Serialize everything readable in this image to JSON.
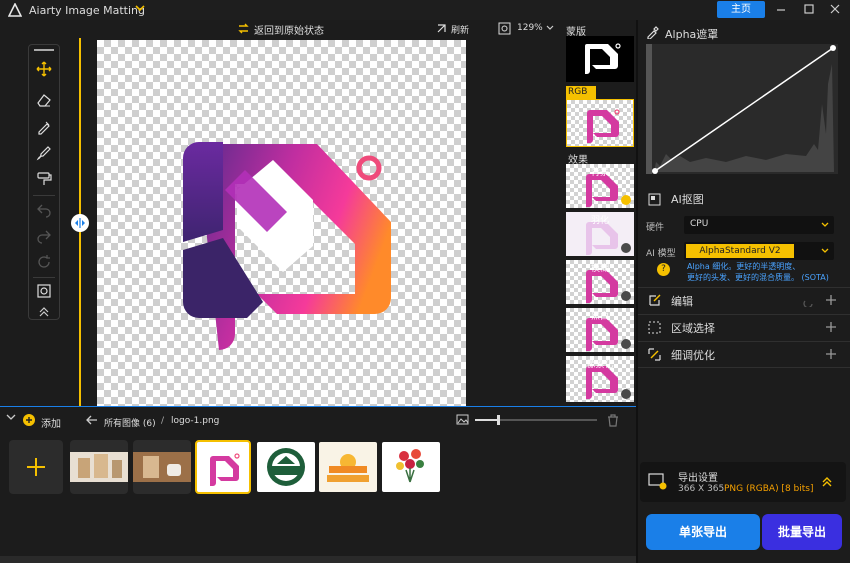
{
  "app": {
    "title": "Aiarty Image Matting",
    "home": "主页"
  },
  "toolbar": {
    "reset": "返回到原始状态",
    "refresh": "刷新",
    "zoom": "129%"
  },
  "right_strip": {
    "mask_label": "蒙版",
    "rgba_label": "RGB A",
    "effects_label": "效果",
    "effects": [
      {
        "label": "背景"
      },
      {
        "label": "羽化"
      },
      {
        "label": "模糊"
      },
      {
        "label": "黑白"
      },
      {
        "label": "像素化"
      }
    ]
  },
  "alpha": {
    "title": "Alpha遮罩"
  },
  "ai": {
    "title": "AI抠图",
    "hardware_label": "硬件",
    "hardware_value": "CPU",
    "model_label": "AI 模型",
    "model_value": "AlphaStandard  V2",
    "desc_line1": "Alpha 细化。更好的半透明度、",
    "desc_line2": "更好的头发、更好的混合质量。  (SOTA)"
  },
  "sections": [
    {
      "label": "编辑"
    },
    {
      "label": "区域选择"
    },
    {
      "label": "细调优化"
    }
  ],
  "export": {
    "title": "导出设置",
    "dims": "366 X 365",
    "format": "PNG (RGBA) [8 bits]",
    "single": "单张导出",
    "batch": "批量导出"
  },
  "bottom": {
    "add": "添加",
    "all_images": "所有图像 (6)",
    "sep": "/",
    "filename": "logo-1.png"
  },
  "colors": {
    "accent": "#f5c000",
    "blue": "#1a7fe8",
    "title_bg": "#1e1e1e"
  }
}
